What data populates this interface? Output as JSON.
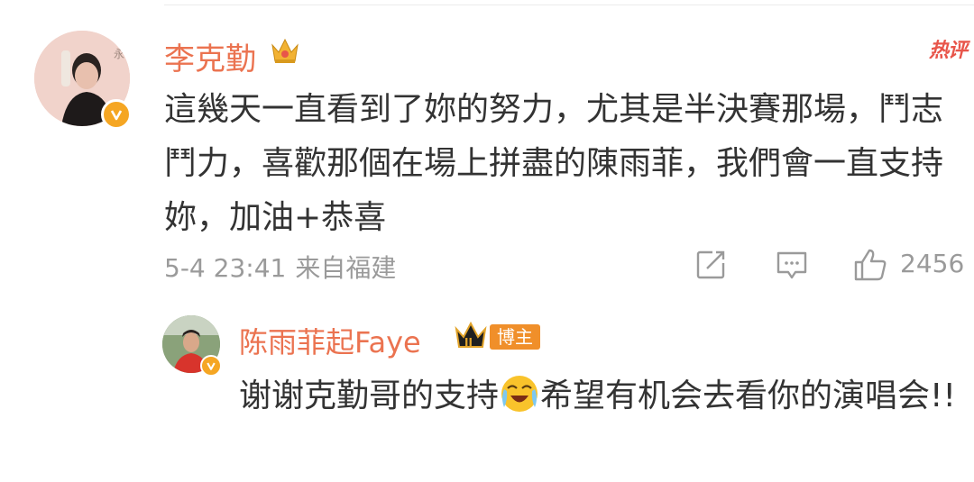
{
  "hot_label": "热评",
  "main_comment": {
    "username": "李克勤",
    "text": "這幾天一直看到了妳的努力，尤其是半決賽那場，鬥志鬥力，喜歡那個在場上拼盡的陳雨菲，我們會一直支持妳，加油+恭喜",
    "date": "5-4 23:41",
    "location": "来自福建",
    "like_count": "2456"
  },
  "reply": {
    "username": "陈雨菲起Faye",
    "role_badge": "博主",
    "text_before": "谢谢克勤哥的支持",
    "emoji": "crying-laughing-emoji",
    "text_after": "希望有机会去看你的演唱会!!"
  },
  "colors": {
    "username": "#eb7350",
    "hot": "#e8554a",
    "meta": "#9a9a9a",
    "verified": "#f5a623",
    "role_badge": "#f08f2a"
  },
  "icons": [
    "share-icon",
    "comment-icon",
    "like-icon",
    "crown-icon",
    "verified-icon"
  ]
}
